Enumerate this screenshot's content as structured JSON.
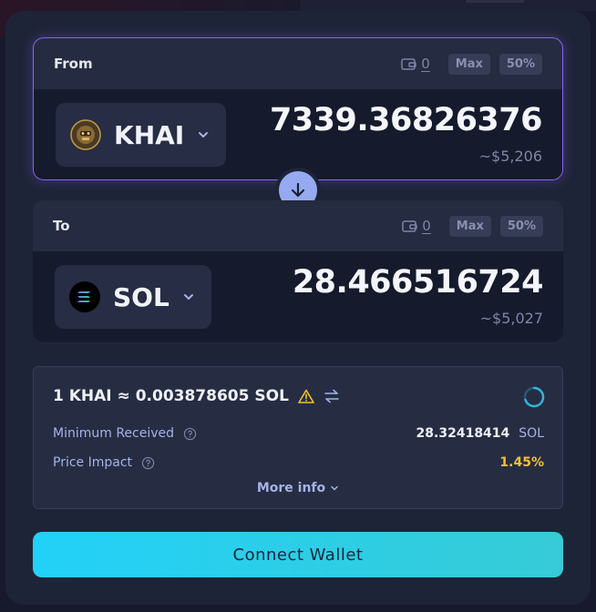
{
  "from_panel": {
    "title": "From",
    "balance": "0",
    "max_label": "Max",
    "half_label": "50%",
    "token": "KHAI",
    "amount": "7339.36826376",
    "usd_value": "~$5,206"
  },
  "to_panel": {
    "title": "To",
    "balance": "0",
    "max_label": "Max",
    "half_label": "50%",
    "token": "SOL",
    "amount": "28.466516724",
    "usd_value": "~$5,027"
  },
  "details": {
    "rate": "1 KHAI ≈ 0.003878605 SOL",
    "min_received_label": "Minimum Received",
    "min_received_value": "28.32418414",
    "min_received_unit": "SOL",
    "price_impact_label": "Price Impact",
    "price_impact_value": "1.45%",
    "more_info_label": "More info"
  },
  "connect_button": {
    "label": "Connect Wallet"
  },
  "icons": {
    "wallet": "wallet-icon",
    "chevron": "chevron-down-icon",
    "swap": "arrow-down-icon",
    "warning": "warning-icon",
    "switch": "swap-horizontal-icon",
    "help": "question-circle-icon",
    "refresh": "loading-spinner-icon"
  },
  "colors": {
    "accent_border": "#8a62f0",
    "swap_button": "#95aaf0",
    "warning": "#f2c12e",
    "connect_start": "#22d1f8",
    "connect_end": "#36cbd6"
  }
}
